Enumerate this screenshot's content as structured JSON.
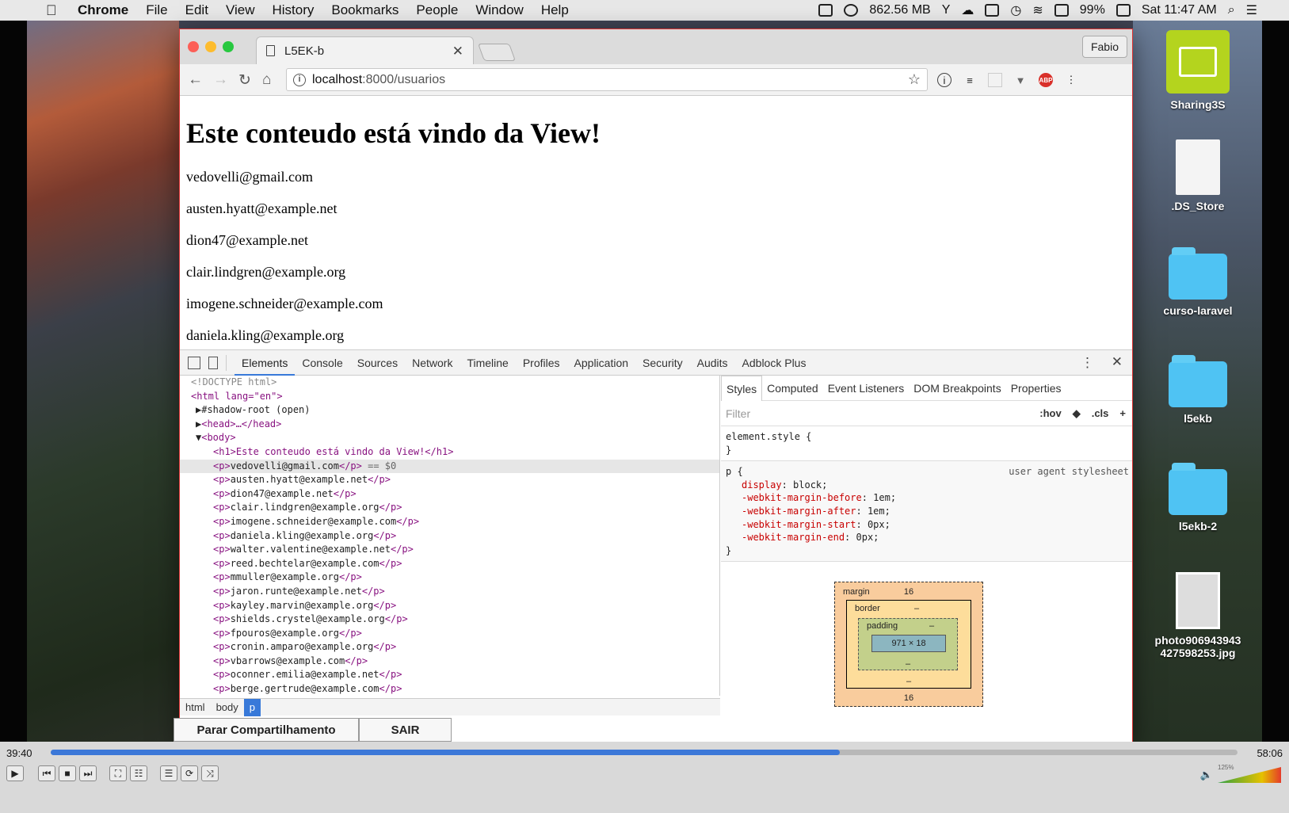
{
  "menubar": {
    "app": "Chrome",
    "items": [
      "File",
      "Edit",
      "View",
      "History",
      "Bookmarks",
      "People",
      "Window",
      "Help"
    ],
    "memory": "862.56 MB",
    "battery": "99%",
    "clock": "Sat 11:47 AM"
  },
  "browser": {
    "tab_title": "L5EK-b",
    "profile": "Fabio",
    "url_host": "localhost",
    "url_path": ":8000/usuarios"
  },
  "page": {
    "heading": "Este conteudo está vindo da View!",
    "emails": [
      "vedovelli@gmail.com",
      "austen.hyatt@example.net",
      "dion47@example.net",
      "clair.lindgren@example.org",
      "imogene.schneider@example.com",
      "daniela.kling@example.org"
    ]
  },
  "devtools": {
    "tabs": [
      "Elements",
      "Console",
      "Sources",
      "Network",
      "Timeline",
      "Profiles",
      "Application",
      "Security",
      "Audits",
      "Adblock Plus"
    ],
    "dom": {
      "doctype": "<!DOCTYPE html>",
      "html_open": "<html lang=\"en\">",
      "shadow": "#shadow-root (open)",
      "head": "<head>…</head>",
      "body_open": "<body>",
      "h1": "<h1>Este conteudo está vindo da View!</h1>",
      "selected_suffix": " == $0",
      "p_items": [
        "vedovelli@gmail.com",
        "austen.hyatt@example.net",
        "dion47@example.net",
        "clair.lindgren@example.org",
        "imogene.schneider@example.com",
        "daniela.kling@example.org",
        "walter.valentine@example.net",
        "reed.bechtelar@example.com",
        "mmuller@example.org",
        "jaron.runte@example.net",
        "kayley.marvin@example.org",
        "shields.crystel@example.org",
        "fpouros@example.org",
        "cronin.amparo@example.org",
        "vbarrows@example.com",
        "oconner.emilia@example.net",
        "berge.gertrude@example.com"
      ]
    },
    "breadcrumbs": [
      "html",
      "body",
      "p"
    ],
    "styles": {
      "tabs": [
        "Styles",
        "Computed",
        "Event Listeners",
        "DOM Breakpoints",
        "Properties"
      ],
      "filter_placeholder": "Filter",
      "hov": ":hov",
      "cls": ".cls",
      "element_style": "element.style {",
      "close_brace": "}",
      "ua_selector": "p {",
      "ua_origin": "user agent stylesheet",
      "props": [
        {
          "name": "display",
          "value": "block;"
        },
        {
          "name": "-webkit-margin-before",
          "value": "1em;"
        },
        {
          "name": "-webkit-margin-after",
          "value": "1em;"
        },
        {
          "name": "-webkit-margin-start",
          "value": "0px;"
        },
        {
          "name": "-webkit-margin-end",
          "value": "0px;"
        }
      ],
      "box": {
        "margin_label": "margin",
        "margin_top": "16",
        "margin_bottom": "16",
        "border_label": "border",
        "padding_label": "padding",
        "dash": "–",
        "content": "971 × 18"
      }
    }
  },
  "share": {
    "stop_label": "Parar Compartilhamento",
    "exit_label": "SAIR"
  },
  "video": {
    "elapsed": "39:40",
    "total": "58:06",
    "progress": 0.665,
    "volume": "125%"
  },
  "desktop": {
    "icons": [
      "Sharing3S",
      ".DS_Store",
      "curso-laravel",
      "l5ekb",
      "l5ekb-2",
      "photo906943943 427598253.jpg"
    ]
  },
  "colors": {
    "accent": "#3879d9",
    "window_border": "#dd3333"
  }
}
